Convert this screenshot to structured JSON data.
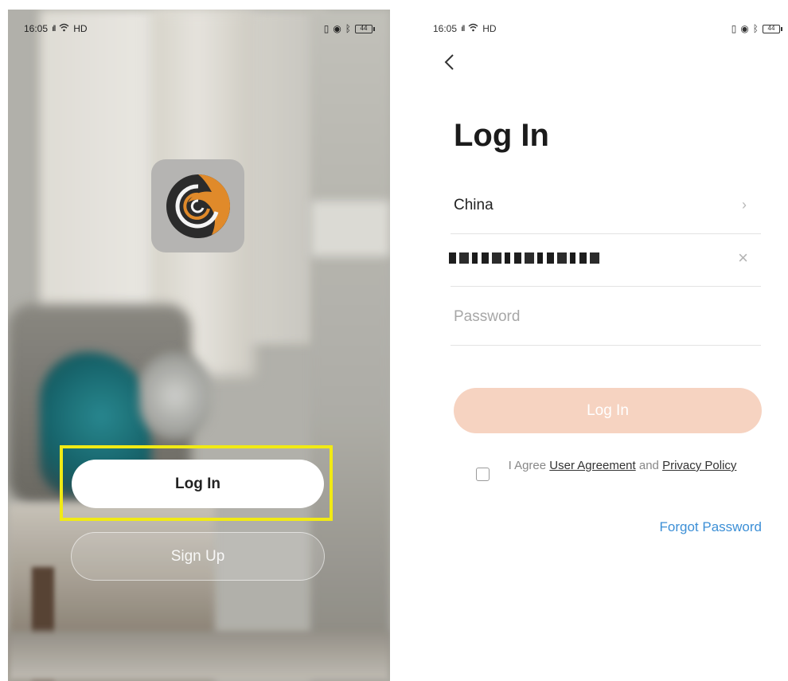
{
  "left_screen": {
    "status": {
      "time": "16:05",
      "network": "HD",
      "battery": "44"
    },
    "buttons": {
      "login": "Log In",
      "signup": "Sign Up"
    }
  },
  "right_screen": {
    "status": {
      "time": "16:05",
      "network": "HD",
      "battery": "44"
    },
    "title": "Log In",
    "country": "China",
    "password_placeholder": "Password",
    "login_button": "Log In",
    "agree": {
      "prefix": "I Agree",
      "user_agreement": "User Agreement",
      "and": "and",
      "privacy": "Privacy Policy"
    },
    "forgot_password": "Forgot Password"
  },
  "colors": {
    "highlight": "#f1ea14",
    "login_button_disabled": "#f6d3c1",
    "link_blue": "#3c8fd6",
    "logo_orange": "#e08a2a"
  }
}
